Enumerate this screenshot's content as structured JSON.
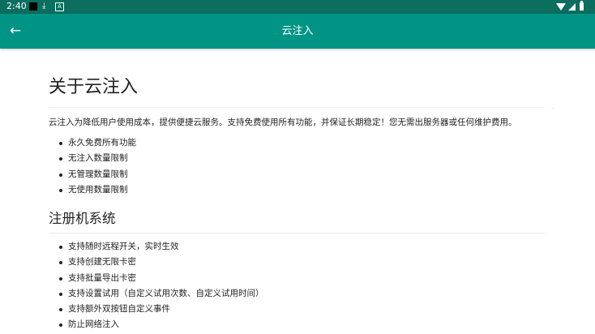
{
  "status_bar": {
    "time": "2:40",
    "left_icons": [
      "black-square-icon",
      "download-icon",
      "a-icon"
    ],
    "a_icon_letter": "A",
    "right_icons": [
      "wifi-icon",
      "signal-icon",
      "battery-icon"
    ]
  },
  "app_bar": {
    "title": "云注入",
    "back_icon": "back-arrow-icon",
    "colors": {
      "app_bar": "#009485",
      "status_bar": "#0b6e5f"
    }
  },
  "content": {
    "heading": "关于云注入",
    "intro": "云注入为降低用户使用成本，提供便捷云服务。支持免费使用所有功能，并保证长期稳定！您无需出服务器或任何维护费用。",
    "features": [
      "永久免费所有功能",
      "无注入数量限制",
      "无管理数量限制",
      "无使用数量限制"
    ],
    "section_title": "注册机系统",
    "register_features": [
      "支持随时远程开关，实时生效",
      "支持创建无限卡密",
      "支持批量导出卡密",
      "支持设置试用（自定义试用次数、自定义试用时间）",
      "支持额外双按钮自定义事件",
      "防止网络注入"
    ]
  }
}
